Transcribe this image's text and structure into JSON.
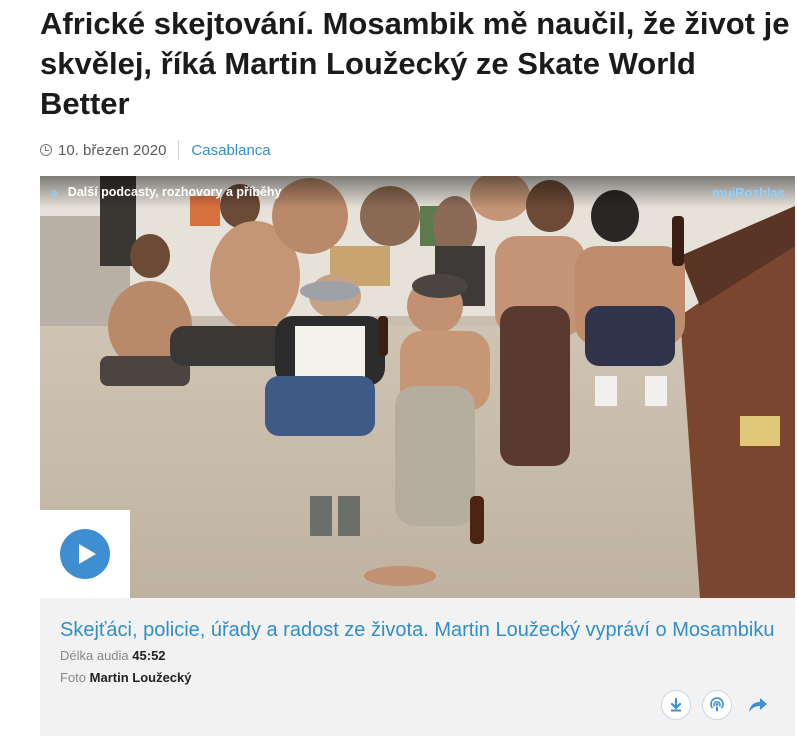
{
  "article": {
    "title": "Africké skejtování. Mosambik mě naučil, že život je skvělej, říká Martin Loužecký ze Skate World Better",
    "date": "10. březen 2020",
    "show": "Casablanca"
  },
  "player": {
    "more_label": "Další podcasty, rozhovory a příběhy",
    "brand": "mujRozhlas",
    "episode_title": "Skejťáci, policie, úřady a radost ze života. Martin Loužecký vypráví o Mosambiku",
    "duration_label": "Délka audia",
    "duration": "45:52",
    "photo_label": "Foto",
    "photo_author": "Martin Loužecký"
  },
  "icons": {
    "play": "play-icon",
    "download": "download-icon",
    "podcast": "podcast-icon",
    "share": "share-icon",
    "clock": "clock-icon",
    "chevrons": "double-chevron-right-icon"
  },
  "colors": {
    "accent": "#2f8fc9",
    "play_button": "#3d8fd1",
    "brand": "#8fd0ff",
    "info_background": "#f2f2f2"
  }
}
